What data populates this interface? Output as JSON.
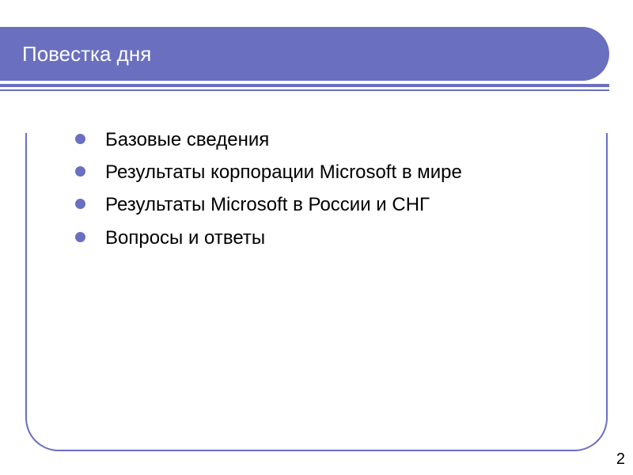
{
  "colors": {
    "accent": "#6a6fbf",
    "text": "#000000",
    "title_text": "#ffffff",
    "background": "#ffffff"
  },
  "title": "Повестка дня",
  "bullets": [
    "Базовые сведения",
    "Результаты корпорации Microsoft в мире",
    "Результаты Microsoft в России и СНГ",
    "Вопросы и ответы"
  ],
  "slide_number": "2"
}
